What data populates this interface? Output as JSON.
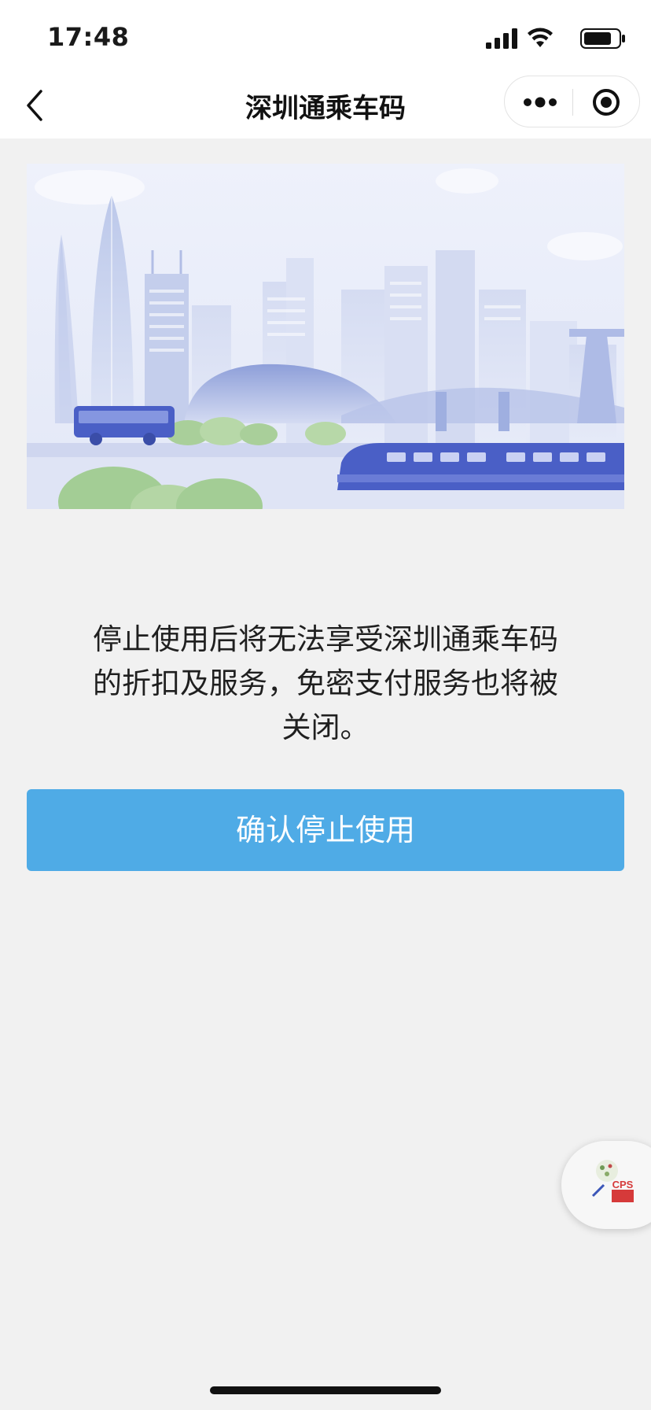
{
  "status_bar": {
    "time": "17:48",
    "icons": [
      "signal-icon",
      "wifi-icon",
      "battery-icon"
    ]
  },
  "nav": {
    "title": "深圳通乘车码",
    "back_icon": "chevron-left-icon",
    "more_icon": "ellipsis-icon",
    "close_icon": "target-close-icon"
  },
  "banner": {
    "description_icon": "city-skyline-illustration"
  },
  "message": {
    "line1": "停止使用后将无法享受深圳通乘车码",
    "line2": "的折扣及服务，免密支付服务也将被",
    "line3": "关闭。"
  },
  "actions": {
    "confirm_label": "确认停止使用"
  },
  "floating_badge": {
    "logo_text": "CPS",
    "icon": "cps-logo-icon"
  },
  "colors": {
    "primary_button": "#4fabe6",
    "page_background": "#f1f1f1",
    "nav_background": "#ffffff"
  }
}
